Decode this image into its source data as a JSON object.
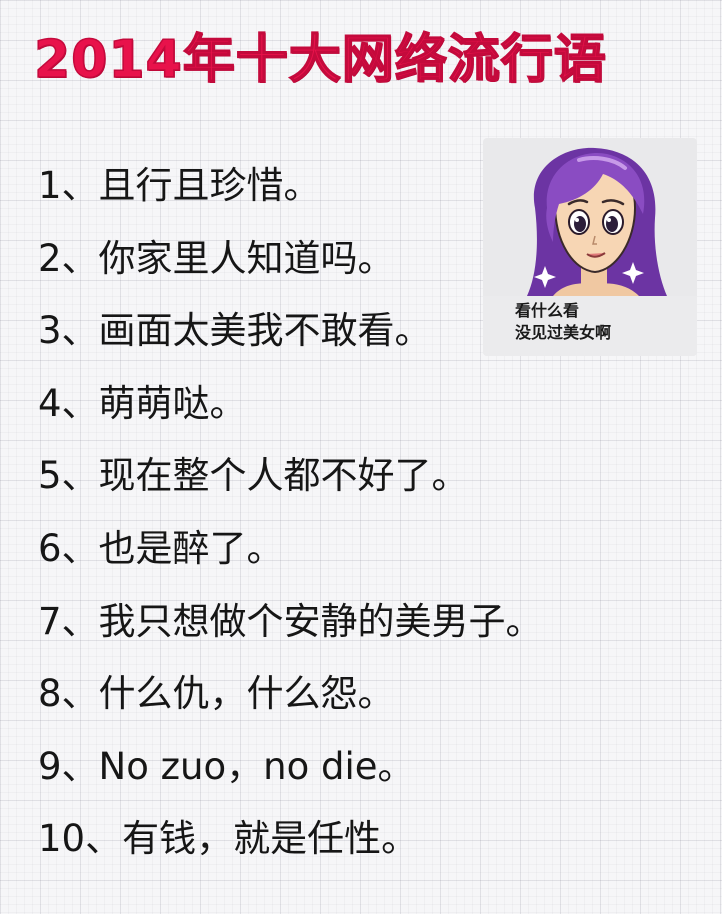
{
  "title": "2014年十大网络流行语",
  "items": [
    {
      "num": "1、",
      "text": "且行且珍惜。"
    },
    {
      "num": "2、",
      "text": "你家里人知道吗。"
    },
    {
      "num": "3、",
      "text": "画面太美我不敢看。"
    },
    {
      "num": "4、",
      "text": "萌萌哒。"
    },
    {
      "num": "5、",
      "text": "现在整个人都不好了。"
    },
    {
      "num": "6、",
      "text": "也是醉了。"
    },
    {
      "num": "7、",
      "text": "我只想做个安静的美男子。"
    },
    {
      "num": "8、",
      "text": "什么仇，什么怨。"
    },
    {
      "num": "9、",
      "text": "No zuo，no die。"
    },
    {
      "num": "10、",
      "text": "有钱，就是任性。"
    }
  ],
  "meme": {
    "caption_line1": "看什么看",
    "caption_line2": "没见过美女啊"
  },
  "colors": {
    "title": "#e8124b",
    "text": "#161616",
    "hair": "#7b3fb0",
    "skin": "#f7d6b4"
  }
}
